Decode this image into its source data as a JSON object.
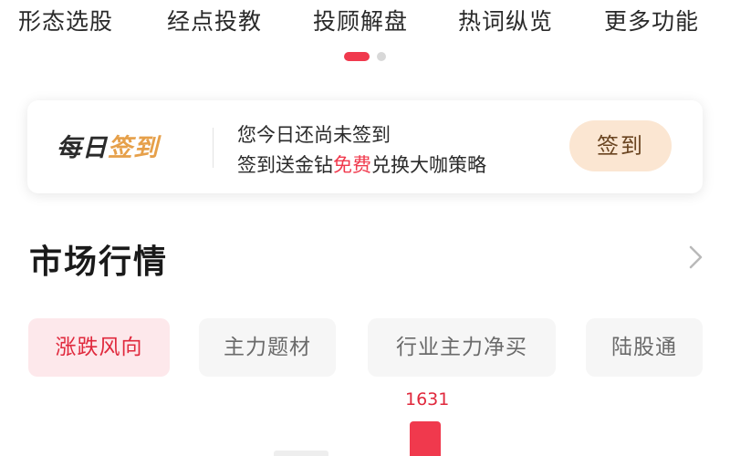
{
  "feature_nav": {
    "items": [
      {
        "label": "形态选股"
      },
      {
        "label": "经点投教"
      },
      {
        "label": "投顾解盘"
      },
      {
        "label": "热词纵览"
      },
      {
        "label": "更多功能"
      }
    ]
  },
  "checkin": {
    "logo_part1": "每日",
    "logo_part2": "签到",
    "status_text": "您今日还尚未签到",
    "promo_prefix": "签到送金钻",
    "promo_highlight": "免费",
    "promo_suffix": "兑换大咖策略",
    "button_label": "签到"
  },
  "market": {
    "title": "市场行情",
    "more_icon": "chevron-right-icon",
    "tabs": [
      {
        "label": "涨跌风向",
        "active": true
      },
      {
        "label": "主力题材",
        "active": false
      },
      {
        "label": "行业主力净买",
        "active": false
      },
      {
        "label": "陆股通",
        "active": false
      }
    ],
    "chart": {
      "bar_value_label": "1631"
    }
  },
  "colors": {
    "accent_red": "#f0394d",
    "checkin_button_bg": "#fbe6d2",
    "logo_gold": "#e6a04a",
    "active_tab_bg": "#fde8eb"
  }
}
